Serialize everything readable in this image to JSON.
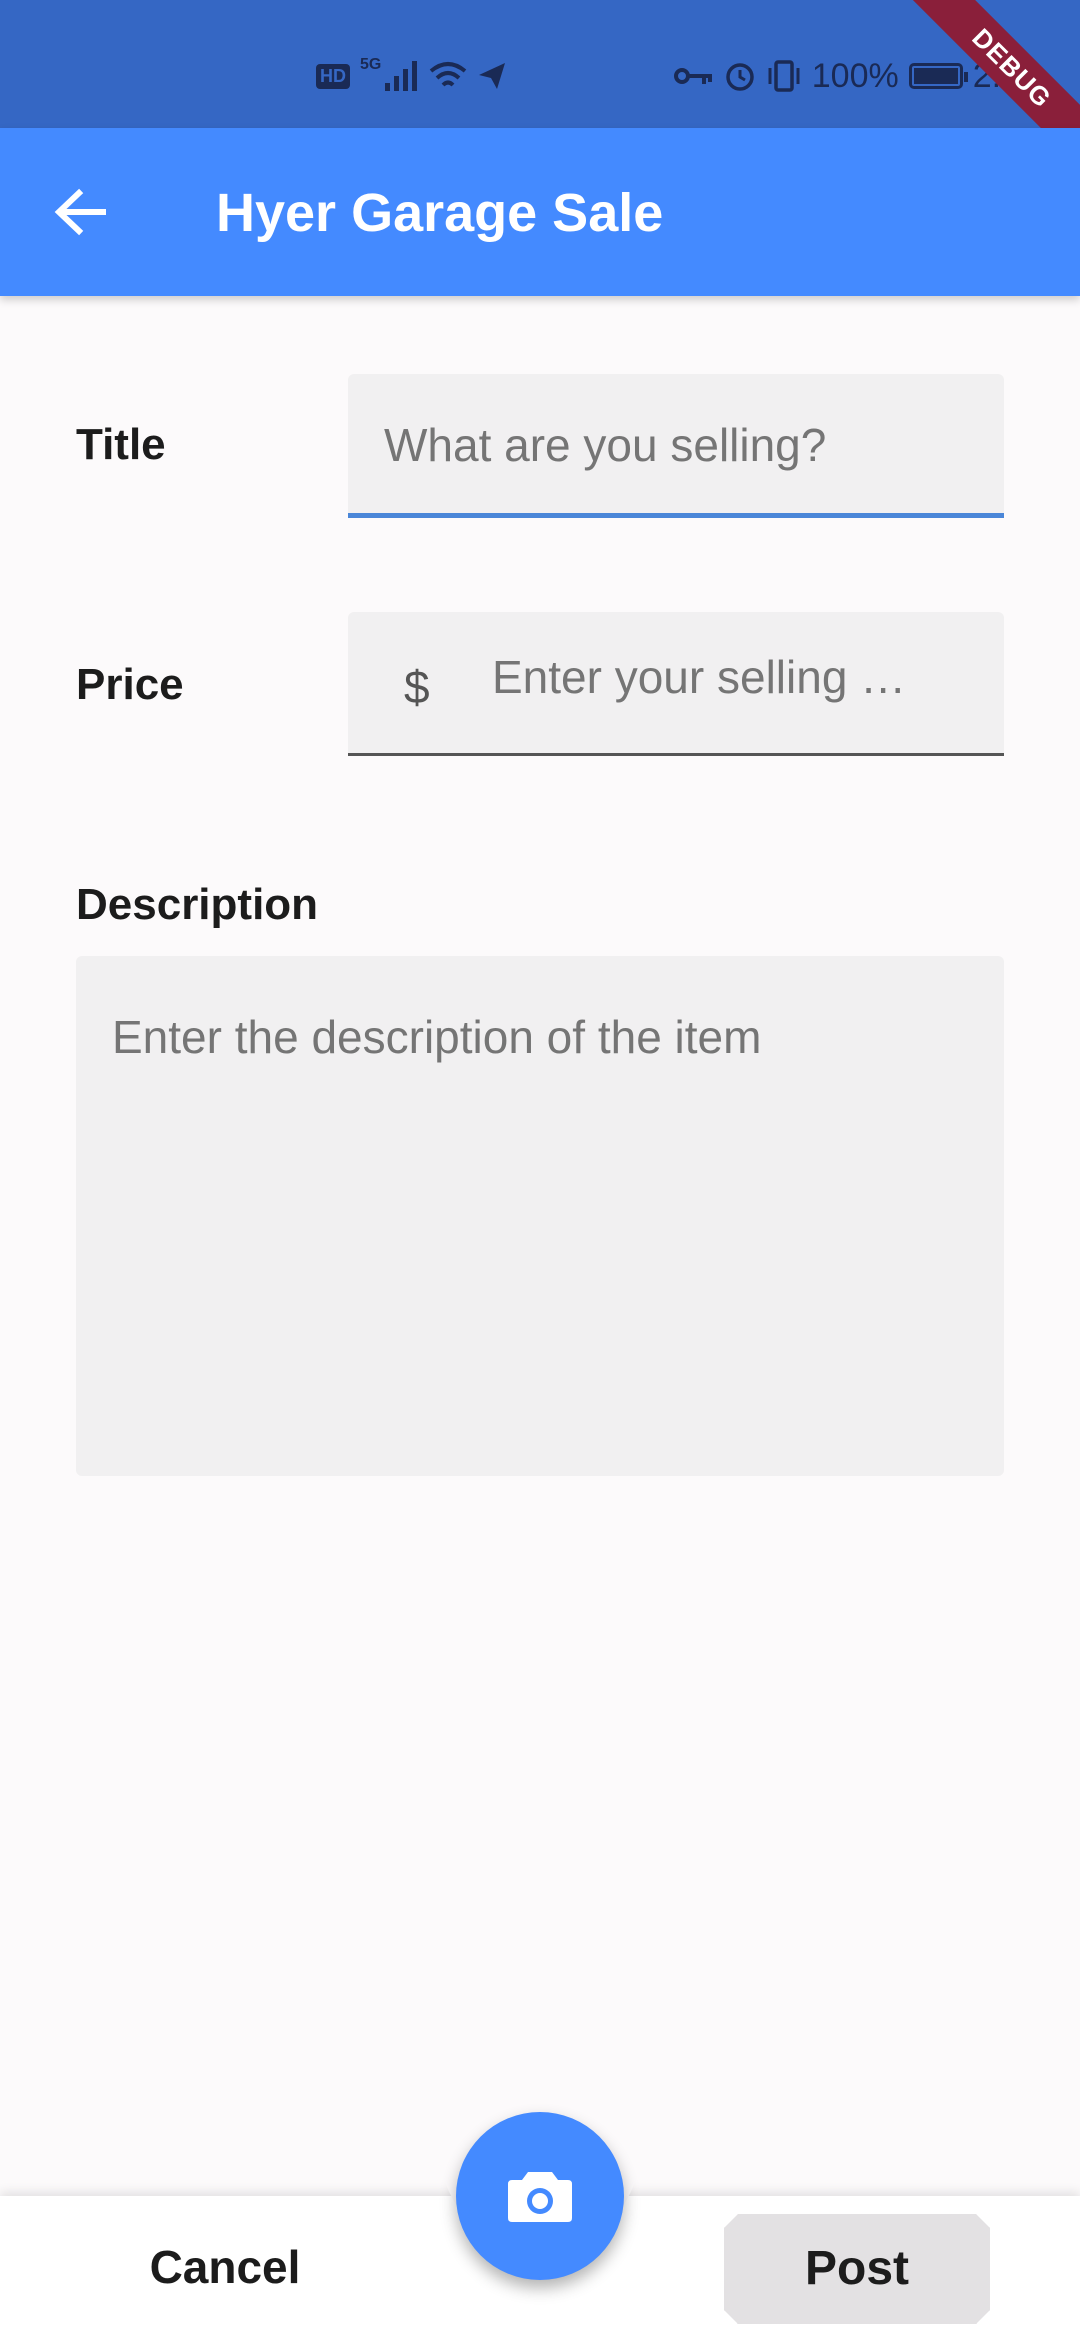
{
  "status_bar": {
    "hd": "HD",
    "network": "5G",
    "battery": "100%",
    "time": "2:2"
  },
  "debug_ribbon": "DEBUG",
  "app_bar": {
    "title": "Hyer Garage Sale",
    "back_icon": "arrow-back-icon"
  },
  "form": {
    "title_label": "Title",
    "title_placeholder": "What are you selling?",
    "price_label": "Price",
    "price_prefix": "$",
    "price_placeholder": "Enter your selling …",
    "description_label": "Description",
    "description_placeholder": "Enter the description of the item"
  },
  "bottom_bar": {
    "cancel_label": "Cancel",
    "post_label": "Post",
    "camera_icon": "camera-icon"
  },
  "colors": {
    "primary": "#448aff",
    "status_bar": "#3567c4",
    "focused_underline": "#4a86d8"
  }
}
